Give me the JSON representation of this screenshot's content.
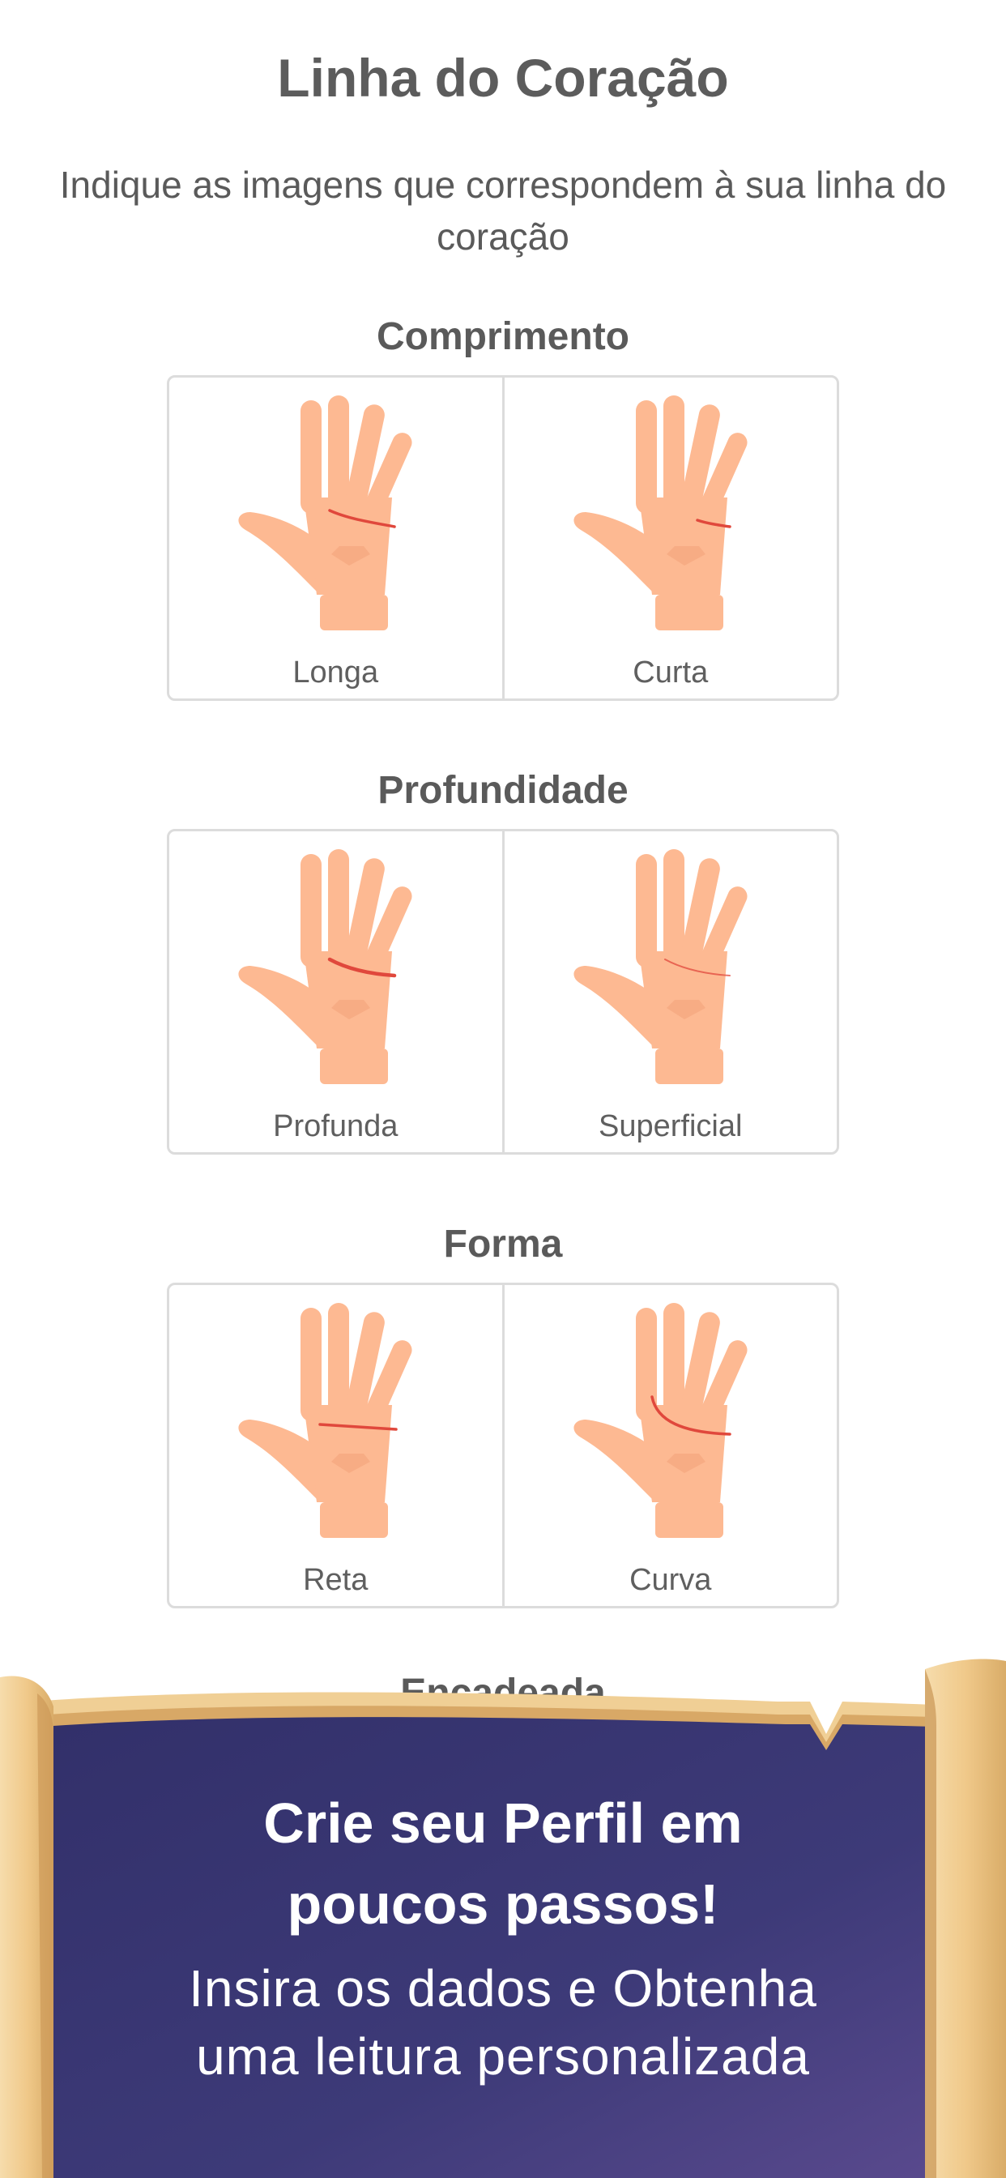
{
  "title": "Linha do Coração",
  "subtitle": "Indique as imagens que correspondem à sua linha do\ncoração",
  "sections": [
    {
      "title": "Comprimento",
      "options": [
        {
          "label": "Longa"
        },
        {
          "label": "Curta"
        }
      ]
    },
    {
      "title": "Profundidade",
      "options": [
        {
          "label": "Profunda"
        },
        {
          "label": "Superficial"
        }
      ]
    },
    {
      "title": "Forma",
      "options": [
        {
          "label": "Reta"
        },
        {
          "label": "Curva"
        }
      ]
    },
    {
      "title": "Encadeada"
    }
  ],
  "promo": {
    "heading": "Crie seu Perfil em\npoucos passos!",
    "subheading": "Insira os dados e Obtenha\numa leitura personalizada"
  },
  "colors": {
    "skin": "#fdb992",
    "skin_shadow": "#f3a47c",
    "line": "#e0483c",
    "banner": "#3c3a72",
    "scroll": "#f1cf97"
  }
}
